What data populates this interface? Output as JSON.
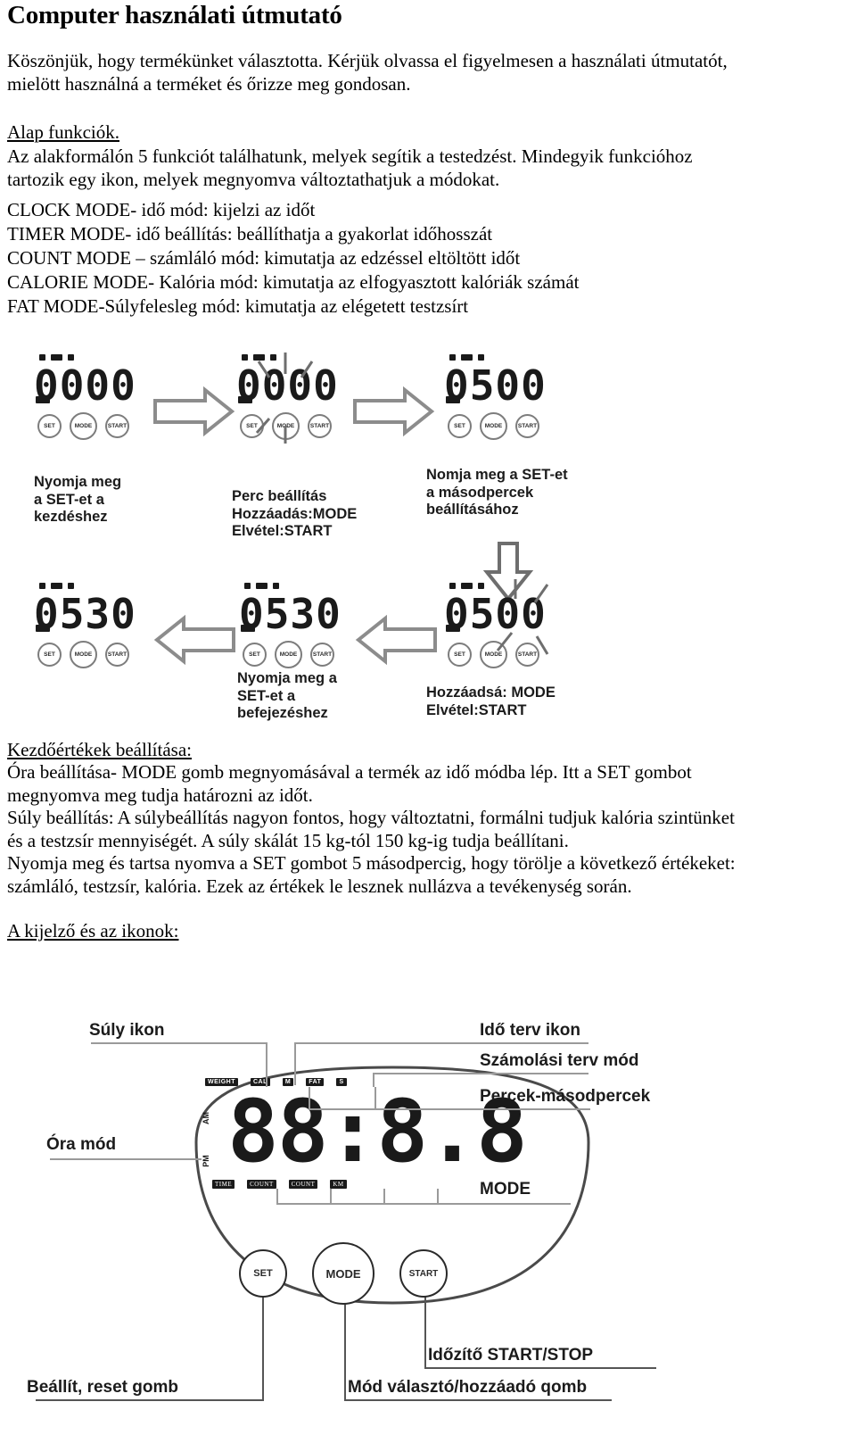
{
  "document": {
    "title": "Computer használati útmutató",
    "intro": [
      "Köszönjük, hogy termékünket választotta. Kérjük olvassa el figyelmesen a használati útmutatót,",
      "mielött használná a terméket és őrizze meg gondosan."
    ],
    "basic_functions_heading": "Alap funkciók.",
    "basic_functions_intro": [
      "Az alakformálón 5 funkciót találhatunk, melyek segítik a testedzést. Mindegyik funkcióhoz",
      "tartozik egy ikon, melyek megnyomva változtathatjuk a módokat."
    ],
    "modes": [
      "CLOCK MODE- idő mód: kijelzi az időt",
      "TIMER MODE- idő beállítás: beállíthatja a gyakorlat időhosszát",
      "COUNT MODE – számláló mód: kimutatja az edzéssel eltöltött időt",
      "CALORIE MODE- Kalória mód: kimutatja az elfogyasztott kalóriák számát",
      "FAT MODE-Súlyfelesleg mód: kimutatja az elégetett testzsírt"
    ],
    "init_heading": "Kezdőértékek beállítása:",
    "init_paragraphs": [
      "Óra beállítása- MODE gomb megnyomásával a termék az idő módba lép. Itt a SET gombot",
      "megnyomva meg tudja határozni az időt.",
      "Súly beállítás: A súlybeállítás nagyon fontos, hogy változtatni, formálni tudjuk kalória szintünket",
      "és a testzsír mennyiségét.  A súly skálát 15 kg-tól 150 kg-ig tudja beállítani.",
      "Nyomja meg és tartsa nyomva a SET gombot 5 másodpercig, hogy törölje a következő értékeket:",
      "számláló, testzsír, kalória. Ezek az értékek le lesznek nullázva a tevékenység során."
    ],
    "display_heading": "A kijelző és az ikonok:"
  },
  "figure_timer_flow": {
    "steps": [
      {
        "display": "0000",
        "buttons": [
          "SET",
          "MODE",
          "START"
        ],
        "caption": "Nyomja meg\na SET-et a\nkezdéshez"
      },
      {
        "display": "0000",
        "buttons": [
          "SET",
          "MODE",
          "START"
        ],
        "caption": "Perc beállítás\nHozzáadás:MODE\nElvétel:START"
      },
      {
        "display": "0500",
        "buttons": [
          "SET",
          "MODE",
          "START"
        ],
        "caption": "Nomja meg a SET-et\na másodpercek\nbeállításához"
      },
      {
        "display": "0500",
        "buttons": [
          "SET",
          "MODE",
          "START"
        ],
        "caption": "Hozzáadsá: MODE\nElvétel:START"
      },
      {
        "display": "0530",
        "buttons": [
          "SET",
          "MODE",
          "START"
        ],
        "caption": "Nyomja meg a\nSET-et a\nbefejezéshez"
      },
      {
        "display": "0530",
        "buttons": [
          "SET",
          "MODE",
          "START"
        ],
        "caption": ""
      }
    ]
  },
  "figure_display": {
    "lcd_value": "88:8.8",
    "callouts": {
      "weight_icon": "Súly ikon",
      "time_plan_icon": "Idő terv ikon",
      "count_plan_mode": "Számolási terv mód",
      "minutes_seconds": "Percek-másodpercek",
      "clock_mode": "Óra mód",
      "mode": "MODE",
      "timer_start_stop": "Időzítő START/STOP",
      "mode_select_add": "Mód választó/hozzáadó qomb",
      "set_reset": "Beállít, reset gomb"
    },
    "indicators_top": [
      "WEIGHT",
      "CAL",
      "M",
      "FAT",
      "S"
    ],
    "indicators_bottom": [
      "TIME",
      "COUNT",
      "COUNT",
      "KM"
    ],
    "indicators_side": [
      "AM",
      "PM"
    ],
    "buttons": [
      "SET",
      "MODE",
      "START"
    ]
  },
  "colors": {
    "ink": "#000000",
    "leader": "#9a9a9a",
    "lcd": "#1a1a1a",
    "page_bg": "#ffffff"
  }
}
